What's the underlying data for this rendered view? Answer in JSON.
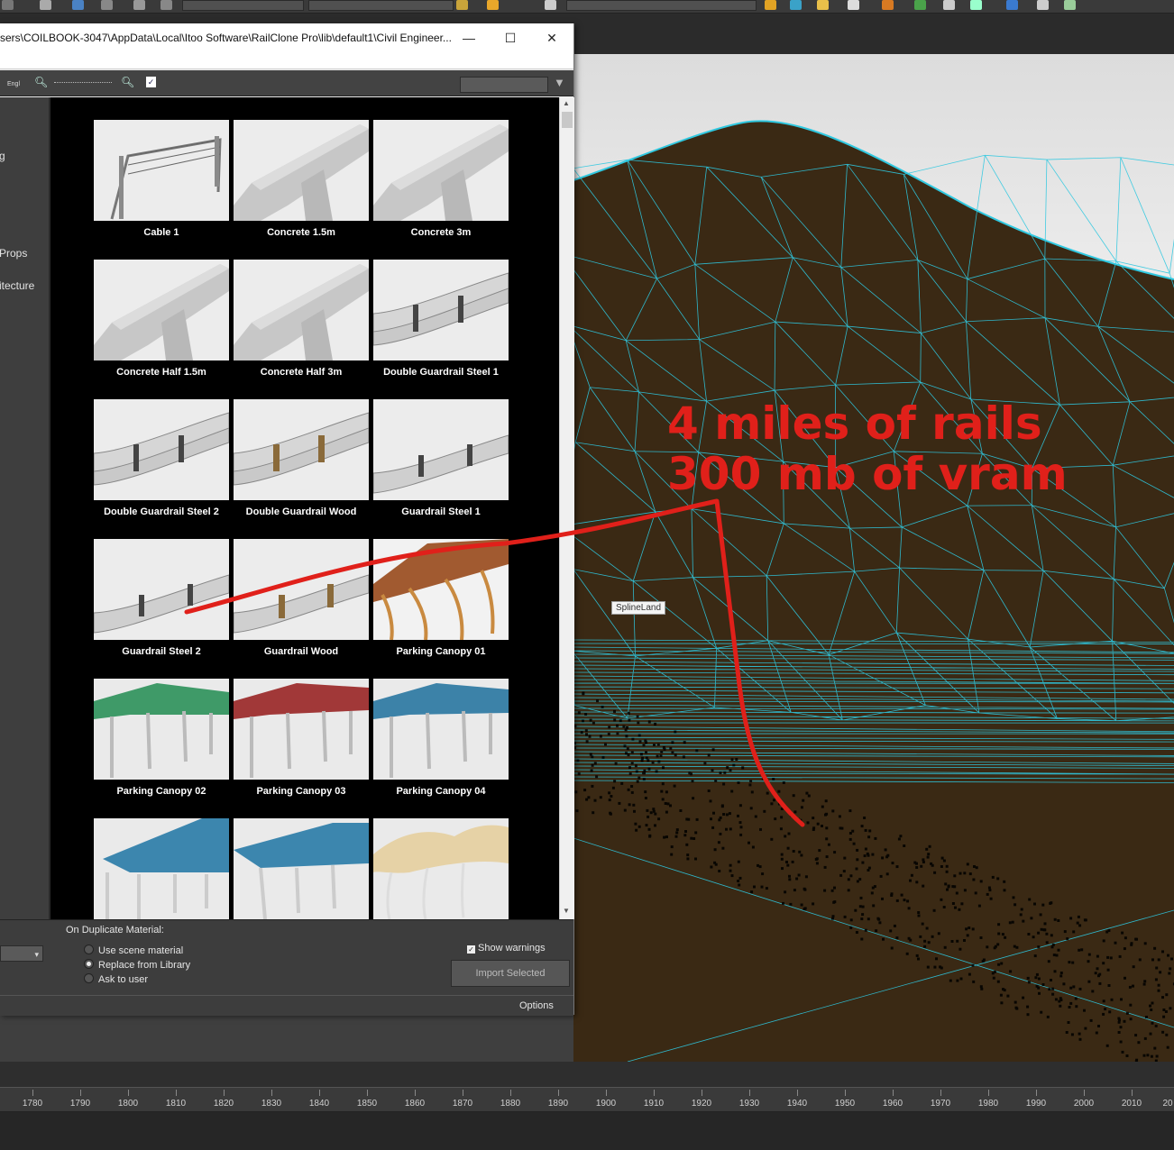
{
  "window": {
    "title": "sers\\COILBOOK-3047\\AppData\\Local\\Itoo Software\\RailClone Pro\\lib\\default1\\Civil Engineer...",
    "minimize_icon": "minimize-icon",
    "maximize_icon": "maximize-icon",
    "close_icon": "close-icon"
  },
  "toolbar": {
    "language": "Engl",
    "icons": [
      "zoom-out-icon",
      "zoom-slider",
      "zoom-in-icon",
      "checklist-icon",
      "filter-icon"
    ]
  },
  "sidebar": {
    "items": [
      {
        "label": "g"
      },
      {
        "label": "Props"
      },
      {
        "label": "itecture"
      }
    ]
  },
  "library": {
    "items": [
      {
        "label": "Cable 1",
        "thumb": "cable"
      },
      {
        "label": "Concrete 1.5m",
        "thumb": "concrete"
      },
      {
        "label": "Concrete 3m",
        "thumb": "concrete"
      },
      {
        "label": "Concrete Half 1.5m",
        "thumb": "concrete"
      },
      {
        "label": "Concrete Half 3m",
        "thumb": "concrete"
      },
      {
        "label": "Double Guardrail Steel 1",
        "thumb": "double-rail"
      },
      {
        "label": "Double Guardrail Steel 2",
        "thumb": "double-rail"
      },
      {
        "label": "Double Guardrail Wood",
        "thumb": "double-rail-wood"
      },
      {
        "label": "Guardrail Steel 1",
        "thumb": "rail"
      },
      {
        "label": "Guardrail Steel 2",
        "thumb": "rail"
      },
      {
        "label": "Guardrail Wood",
        "thumb": "rail-wood"
      },
      {
        "label": "Parking Canopy 01",
        "thumb": "canopy-wood"
      },
      {
        "label": "Parking Canopy 02",
        "thumb": "canopy-green"
      },
      {
        "label": "Parking Canopy 03",
        "thumb": "canopy-red"
      },
      {
        "label": "Parking Canopy 04",
        "thumb": "canopy-blue"
      },
      {
        "label": "",
        "thumb": "canopy-blue2"
      },
      {
        "label": "",
        "thumb": "canopy-blue3"
      },
      {
        "label": "",
        "thumb": "canopy-tent"
      }
    ]
  },
  "bottom": {
    "duplicate_title": "On Duplicate Material:",
    "options": [
      {
        "label": "Use scene material",
        "selected": false
      },
      {
        "label": "Replace from Library",
        "selected": true
      },
      {
        "label": "Ask to user",
        "selected": false
      }
    ],
    "show_warnings": "Show warnings",
    "show_warnings_checked": true,
    "import_button": "Import Selected",
    "options_label": "Options"
  },
  "viewport": {
    "object_label": "SplineLand",
    "wire_color": "#2fc8e0"
  },
  "annotation": {
    "line1": "4 miles of rails",
    "line2": "300 mb of vram",
    "color": "#e0201a"
  },
  "timeline": {
    "ticks": [
      "1780",
      "1790",
      "1800",
      "1810",
      "1820",
      "1830",
      "1840",
      "1850",
      "1860",
      "1870",
      "1880",
      "1890",
      "1900",
      "1910",
      "1920",
      "1930",
      "1940",
      "1950",
      "1960",
      "1970",
      "1980",
      "1990",
      "2000",
      "2010",
      "20"
    ]
  }
}
